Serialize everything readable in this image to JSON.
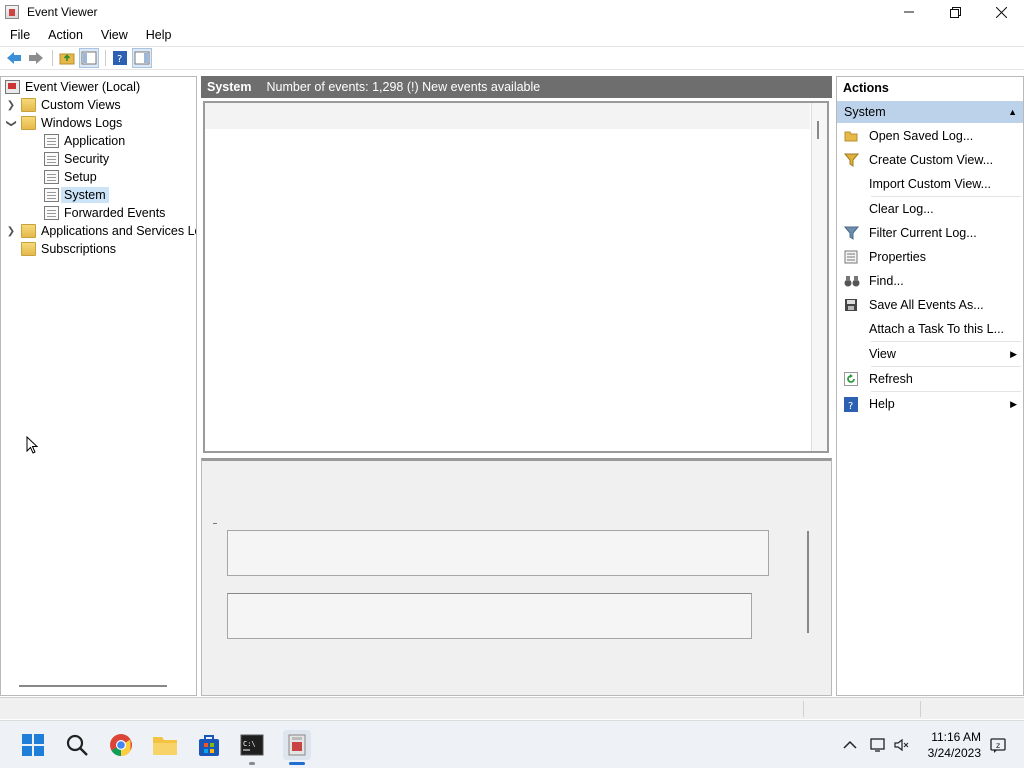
{
  "window": {
    "title": "Event Viewer",
    "buttons": [
      "minimize",
      "maximize",
      "close"
    ]
  },
  "menu": [
    "File",
    "Action",
    "View",
    "Help"
  ],
  "toolbar": [
    "back-icon",
    "forward-icon",
    "up-folder-icon",
    "show-hide-tree-icon",
    "help-icon",
    "show-hide-action-pane-icon"
  ],
  "tree": {
    "root": "Event Viewer (Local)",
    "custom_views": "Custom Views",
    "windows_logs": "Windows Logs",
    "logs": [
      "Application",
      "Security",
      "Setup",
      "System",
      "Forwarded Events"
    ],
    "selected": "System",
    "apps_services": "Applications and Services Lo",
    "subscriptions": "Subscriptions"
  },
  "center": {
    "title": "System",
    "status": "Number of events: 1,298 (!) New events available"
  },
  "actions": {
    "title": "Actions",
    "section": "System",
    "items": [
      {
        "label": "Open Saved Log...",
        "icon": "open-folder-icon"
      },
      {
        "label": "Create Custom View...",
        "icon": "funnel-icon"
      },
      {
        "label": "Import Custom View...",
        "icon": ""
      },
      {
        "label": "Clear Log...",
        "icon": ""
      },
      {
        "label": "Filter Current Log...",
        "icon": "filter-icon"
      },
      {
        "label": "Properties",
        "icon": "properties-icon"
      },
      {
        "label": "Find...",
        "icon": "binoculars-icon"
      },
      {
        "label": "Save All Events As...",
        "icon": "save-icon"
      },
      {
        "label": "Attach a Task To this L...",
        "icon": ""
      },
      {
        "label": "View",
        "icon": "",
        "submenu": true
      },
      {
        "label": "Refresh",
        "icon": "refresh-icon"
      },
      {
        "label": "Help",
        "icon": "help-icon",
        "submenu": true
      }
    ]
  },
  "taskbar": {
    "apps": [
      "start-icon",
      "search-icon",
      "chrome-icon",
      "file-explorer-icon",
      "store-icon",
      "terminal-icon",
      "event-viewer-icon"
    ],
    "time": "11:16 AM",
    "date": "3/24/2023"
  }
}
